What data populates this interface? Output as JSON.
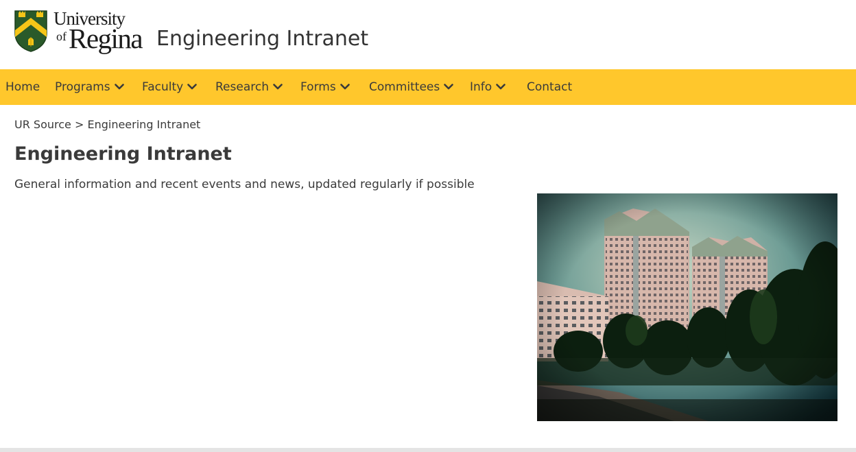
{
  "logo": {
    "line1": "University",
    "of": "of",
    "regina": "Regina"
  },
  "site": {
    "title": "Engineering Intranet"
  },
  "colors": {
    "nav_bg": "#ffc72c",
    "crest_green": "#2a5a2a",
    "crest_gold": "#f5c518"
  },
  "nav": {
    "items": [
      {
        "label": "Home",
        "dropdown": false
      },
      {
        "label": "Programs",
        "dropdown": true
      },
      {
        "label": "Faculty",
        "dropdown": true
      },
      {
        "label": "Research",
        "dropdown": true
      },
      {
        "label": "Forms",
        "dropdown": true
      },
      {
        "label": "Committees",
        "dropdown": true
      },
      {
        "label": "Info",
        "dropdown": true
      },
      {
        "label": "Contact",
        "dropdown": false
      }
    ],
    "dropdown_icon": "chevron-down-icon"
  },
  "breadcrumb": {
    "root": "UR Source",
    "separator": ">",
    "current": "Engineering Intranet"
  },
  "page": {
    "title": "Engineering Intranet",
    "intro": "General information and recent events and news, updated regularly if possible"
  }
}
